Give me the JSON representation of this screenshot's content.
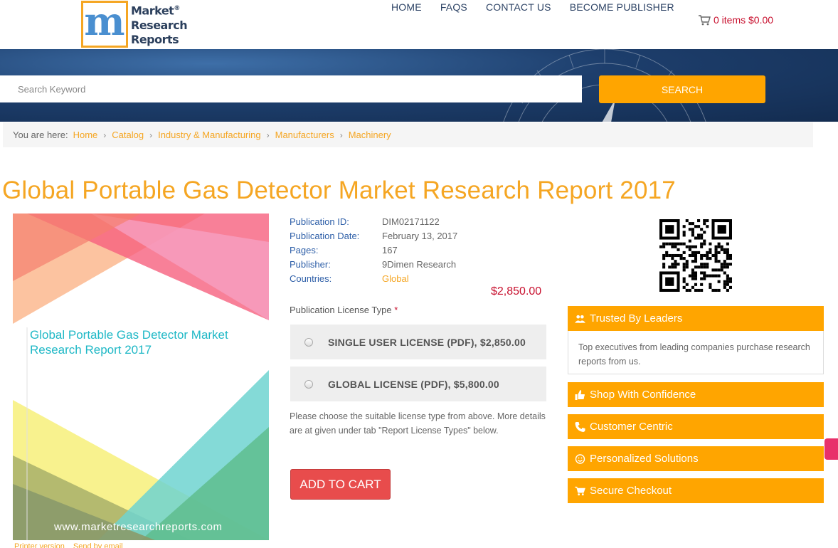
{
  "header": {
    "logo": {
      "text_1": "Market",
      "text_2": "Research",
      "text_3": "Reports",
      "registered": "®",
      "mark": "m"
    },
    "nav": [
      "HOME",
      "FAQS",
      "CONTACT US",
      "BECOME PUBLISHER"
    ],
    "cart": {
      "text": "0 items $0.00",
      "icon": "cart-icon"
    }
  },
  "search": {
    "placeholder": "Search Keyword",
    "button": "SEARCH"
  },
  "breadcrumb": {
    "label": "You are here:",
    "items": [
      "Home",
      "Catalog",
      "Industry & Manufacturing",
      "Manufacturers",
      "Machinery"
    ]
  },
  "report": {
    "title": "Global Portable Gas Detector Market Research Report 2017",
    "cover_title": "Global Portable Gas Detector Market Research Report 2017",
    "cover_url": "www.marketresearchreports.com",
    "below_cover": [
      "Printer version",
      "Send by email"
    ],
    "details": [
      {
        "key": "Publication ID:",
        "value": "DIM02171122"
      },
      {
        "key": "Publication Date:",
        "value": "February 13, 2017"
      },
      {
        "key": "Pages:",
        "value": "167"
      },
      {
        "key": "Publisher:",
        "value": "9Dimen Research"
      },
      {
        "key": "Countries:",
        "value": "Global"
      }
    ],
    "price": "$2,850.00",
    "license_label": "Publication License Type",
    "required_mark": "*",
    "licenses": [
      "SINGLE USER LICENSE (PDF), $2,850.00",
      "GLOBAL LICENSE (PDF), $5,800.00"
    ],
    "license_note": "Please choose the suitable license type from above. More details are at given under tab \"Report License Types\" below.",
    "add_to_cart": "ADD TO CART"
  },
  "sidebar": {
    "trusted": {
      "title": "Trusted By Leaders",
      "body": "Top executives from leading companies purchase research reports from us.",
      "icon": "users-icon"
    },
    "items": [
      {
        "title": "Shop With Confidence",
        "icon": "thumbs-up-icon"
      },
      {
        "title": "Customer Centric",
        "icon": "phone-icon"
      },
      {
        "title": "Personalized Solutions",
        "icon": "smile-icon"
      },
      {
        "title": "Secure Checkout",
        "icon": "cart-icon"
      }
    ]
  },
  "colors": {
    "accent": "#ffa500",
    "title": "#f5a623",
    "price": "#c8102e",
    "cart_button": "#e84c4c",
    "banner": "#1d3e6c"
  }
}
